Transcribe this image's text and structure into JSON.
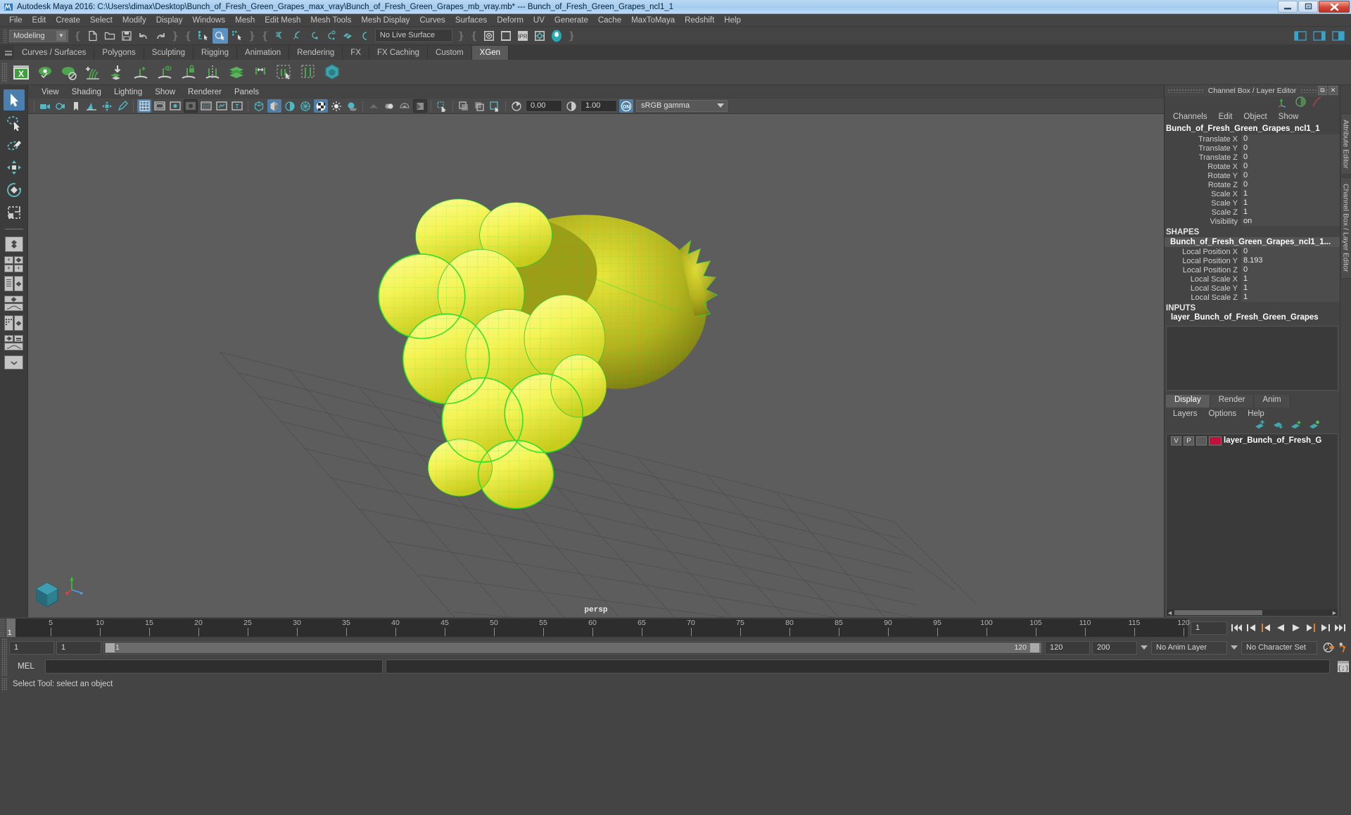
{
  "window": {
    "title": "Autodesk Maya 2016: C:\\Users\\dimax\\Desktop\\Bunch_of_Fresh_Green_Grapes_max_vray\\Bunch_of_Fresh_Green_Grapes_mb_vray.mb*   ---   Bunch_of_Fresh_Green_Grapes_ncl1_1",
    "app_icon": "maya-icon",
    "minimize_label": "–",
    "restore_label": "❐",
    "close_label": "✕"
  },
  "menubar": {
    "items": [
      {
        "label": "File"
      },
      {
        "label": "Edit"
      },
      {
        "label": "Create"
      },
      {
        "label": "Select"
      },
      {
        "label": "Modify"
      },
      {
        "label": "Display"
      },
      {
        "label": "Windows"
      },
      {
        "label": "Mesh"
      },
      {
        "label": "Edit Mesh"
      },
      {
        "label": "Mesh Tools"
      },
      {
        "label": "Mesh Display"
      },
      {
        "label": "Curves"
      },
      {
        "label": "Surfaces"
      },
      {
        "label": "Deform"
      },
      {
        "label": "UV"
      },
      {
        "label": "Generate"
      },
      {
        "label": "Cache"
      },
      {
        "label": "MaxToMaya"
      },
      {
        "label": "Redshift"
      },
      {
        "label": "Help"
      }
    ]
  },
  "statusline": {
    "menuset": "Modeling",
    "menuset_caret": "▼",
    "live_surface": "No Live Surface",
    "icons": {
      "new_scene": "new-scene-icon",
      "open_scene": "open-scene-icon",
      "save_scene": "save-scene-icon",
      "undo": "undo-icon",
      "redo": "redo-icon",
      "select_hierarchy": "select-by-hierarchy-icon",
      "select_object": "select-by-object-type-icon",
      "select_component": "select-by-component-type-icon",
      "snap_grid": "snap-to-grid-icon",
      "snap_curve": "snap-to-curve-icon",
      "snap_point": "snap-to-point-icon",
      "snap_projected": "snap-to-projected-center-icon",
      "snap_view_plane": "snap-to-view-plane-icon",
      "make_live": "make-live-icon",
      "render_current": "render-current-frame-icon",
      "render_sequence": "render-sequence-icon",
      "ipr_render": "ipr-render-icon",
      "render_settings": "render-settings-icon",
      "hypershade": "hypershade-icon",
      "show_hide_editors": "show-hide-editors-icon"
    }
  },
  "shelf": {
    "tabs": [
      {
        "label": "Curves / Surfaces",
        "active": false
      },
      {
        "label": "Polygons",
        "active": false
      },
      {
        "label": "Sculpting",
        "active": false
      },
      {
        "label": "Rigging",
        "active": false
      },
      {
        "label": "Animation",
        "active": false
      },
      {
        "label": "Rendering",
        "active": false
      },
      {
        "label": "FX",
        "active": false
      },
      {
        "label": "FX Caching",
        "active": false
      },
      {
        "label": "Custom",
        "active": false
      },
      {
        "label": "XGen",
        "active": true
      }
    ],
    "icons": [
      "xgen-editor-icon",
      "preview-eye-icon",
      "disable-preview-icon",
      "add-description-icon",
      "import-collection-icon",
      "create-groomable-icon",
      "preview-guide-icon",
      "lock-guide-icon",
      "mirror-guide-icon",
      "layered-patch-icon",
      "distribute-icon",
      "select-guides-icon",
      "clump-region-icon",
      "xgen-node-icon"
    ]
  },
  "toolbox": {
    "tools": [
      {
        "name": "select-tool",
        "active": true
      },
      {
        "name": "lasso-select-tool",
        "active": false
      },
      {
        "name": "paint-select-tool",
        "active": false
      },
      {
        "name": "move-tool",
        "active": false
      },
      {
        "name": "rotate-tool",
        "active": false
      },
      {
        "name": "scale-tool",
        "active": false
      }
    ],
    "layouts": [
      "single-perspective-layout",
      "four-view-layout",
      "outliner-persp-layout",
      "persp-graph-layout",
      "hypershade-persp-layout",
      "persp-graph-outliner-layout",
      "more-layouts"
    ]
  },
  "viewport": {
    "menus": [
      {
        "label": "View"
      },
      {
        "label": "Shading"
      },
      {
        "label": "Lighting"
      },
      {
        "label": "Show"
      },
      {
        "label": "Renderer"
      },
      {
        "label": "Panels"
      }
    ],
    "exposure": "0.00",
    "gamma_value": "1.00",
    "view_transform": "sRGB gamma",
    "color_mgmt_state": "ON",
    "camera_label": "persp",
    "toolbar_icons": [
      "select-camera-icon",
      "camera-attributes-icon",
      "bookmark-icon",
      "image-plane-icon",
      "2d-pan-zoom-icon",
      "grease-pencil-icon",
      "grid-toggle-icon",
      "film-gate-icon",
      "resolution-gate-icon",
      "gate-mask-icon",
      "field-chart-icon",
      "safe-action-icon",
      "safe-title-icon",
      "wireframe-icon",
      "smooth-shade-all-icon",
      "shade-flat-icon",
      "wireframe-on-shaded-icon",
      "textured-icon",
      "use-default-lighting-icon",
      "shadows-icon",
      "screen-space-ao-icon",
      "motion-blur-icon",
      "multisample-aa-icon",
      "depth-of-field-icon",
      "isolate-select-icon",
      "xray-icon",
      "xray-joints-icon",
      "xray-active-components-icon",
      "exposure-icon",
      "contrast-icon",
      "color-management-icon"
    ]
  },
  "channelbox": {
    "panel_title": "Channel Box / Layer Editor",
    "menus": [
      {
        "label": "Channels"
      },
      {
        "label": "Edit"
      },
      {
        "label": "Object"
      },
      {
        "label": "Show"
      }
    ],
    "object_name": "Bunch_of_Fresh_Green_Grapes_ncl1_1",
    "transform_channels": [
      {
        "label": "Translate X",
        "value": "0"
      },
      {
        "label": "Translate Y",
        "value": "0"
      },
      {
        "label": "Translate Z",
        "value": "0"
      },
      {
        "label": "Rotate X",
        "value": "0"
      },
      {
        "label": "Rotate Y",
        "value": "0"
      },
      {
        "label": "Rotate Z",
        "value": "0"
      },
      {
        "label": "Scale X",
        "value": "1"
      },
      {
        "label": "Scale Y",
        "value": "1"
      },
      {
        "label": "Scale Z",
        "value": "1"
      },
      {
        "label": "Visibility",
        "value": "on"
      }
    ],
    "shapes_header": "SHAPES",
    "shape_name": "Bunch_of_Fresh_Green_Grapes_ncl1_1...",
    "shape_channels": [
      {
        "label": "Local Position X",
        "value": "0"
      },
      {
        "label": "Local Position Y",
        "value": "8.193"
      },
      {
        "label": "Local Position Z",
        "value": "0"
      },
      {
        "label": "Local Scale X",
        "value": "1"
      },
      {
        "label": "Local Scale Y",
        "value": "1"
      },
      {
        "label": "Local Scale Z",
        "value": "1"
      }
    ],
    "inputs_header": "INPUTS",
    "input_name": "layer_Bunch_of_Fresh_Green_Grapes",
    "dock_icons": [
      "undock-icon",
      "close-panel-icon"
    ],
    "header_icons": [
      "axis-gizmo-icon",
      "half-circle-icon",
      "red-slash-icon"
    ]
  },
  "layereditor": {
    "tabs": [
      {
        "label": "Display",
        "active": true
      },
      {
        "label": "Render",
        "active": false
      },
      {
        "label": "Anim",
        "active": false
      }
    ],
    "menus": [
      {
        "label": "Layers"
      },
      {
        "label": "Options"
      },
      {
        "label": "Help"
      }
    ],
    "buttons": [
      "move-layer-up-icon",
      "move-layer-down-icon",
      "new-layer-icon",
      "new-layer-from-selected-icon"
    ],
    "layers": [
      {
        "visibility": "V",
        "playback": "P",
        "shading": "",
        "color": "#c1103c",
        "name": "layer_Bunch_of_Fresh_G"
      }
    ]
  },
  "sidetabs": [
    {
      "label": "Attribute Editor"
    },
    {
      "label": "Channel Box / Layer Editor"
    }
  ],
  "timeslider": {
    "start_frame": "1",
    "current_frame": "1",
    "ticks": [
      5,
      10,
      15,
      20,
      25,
      30,
      35,
      40,
      45,
      50,
      55,
      60,
      65,
      70,
      75,
      80,
      85,
      90,
      95,
      100,
      105,
      110,
      115,
      120
    ],
    "max_tick": 120,
    "playback_buttons": [
      "go-to-start-icon",
      "step-back-frame-icon",
      "step-back-key-icon",
      "play-backwards-icon",
      "play-forwards-icon",
      "step-forward-key-icon",
      "step-forward-frame-icon",
      "go-to-end-icon"
    ]
  },
  "rangeslider": {
    "anim_start": "1",
    "range_start": "1",
    "bar_start_label": "1",
    "bar_end_label": "120",
    "range_end": "120",
    "anim_end": "200",
    "anim_layer": "No Anim Layer",
    "character_set": "No Character Set",
    "icons": [
      "auto-keyframe-icon",
      "animation-preferences-icon"
    ]
  },
  "commandline": {
    "language_label": "MEL",
    "input_value": "",
    "output_value": "",
    "script_editor_icon": "script-editor-icon"
  },
  "helpline": {
    "text": "Select Tool: select an object"
  },
  "colors": {
    "accent_blue": "#5b92c4",
    "shelf_green": "#5aa85a",
    "layer_red": "#c1103c",
    "viewport_bg": "#5d5d5d",
    "highlight_green": "#00ff00",
    "grape_yellow": "#f2f24a",
    "leaf_olive": "#9a9a10",
    "orange_marker": "#e08030"
  }
}
